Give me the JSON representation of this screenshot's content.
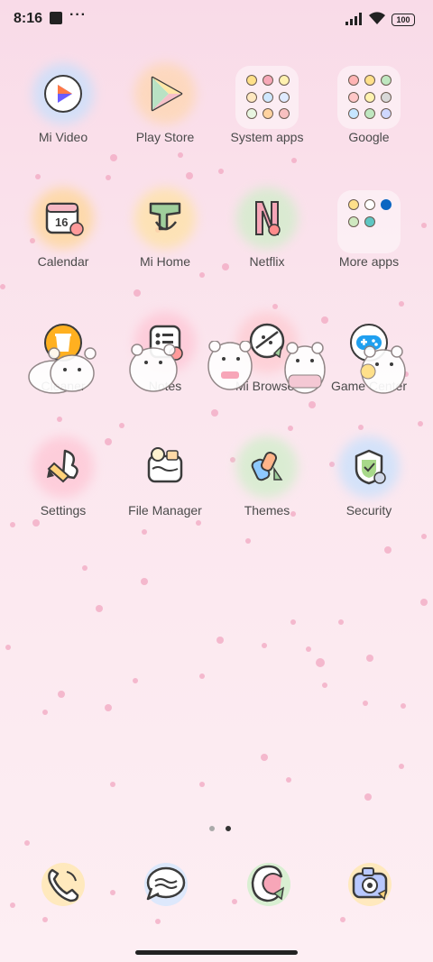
{
  "status_bar": {
    "time": "8:16",
    "more": "···",
    "battery": "100"
  },
  "rows": [
    [
      {
        "label": "Mi Video",
        "icon": "mi-video-icon"
      },
      {
        "label": "Play Store",
        "icon": "play-store-icon"
      },
      {
        "label": "System apps",
        "icon": "folder-icon"
      },
      {
        "label": "Google",
        "icon": "folder-icon"
      }
    ],
    [
      {
        "label": "Calendar",
        "icon": "calendar-icon",
        "badge": "16"
      },
      {
        "label": "Mi Home",
        "icon": "mi-home-icon"
      },
      {
        "label": "Netflix",
        "icon": "netflix-icon"
      },
      {
        "label": "More apps",
        "icon": "folder-icon"
      }
    ],
    [
      {
        "label": "Cleaner",
        "icon": "cleaner-icon"
      },
      {
        "label": "Notes",
        "icon": "notes-icon"
      },
      {
        "label": "Mi Browser",
        "icon": "browser-icon"
      },
      {
        "label": "Game Center",
        "icon": "game-center-icon"
      }
    ],
    [
      {
        "label": "Settings",
        "icon": "settings-icon"
      },
      {
        "label": "File Manager",
        "icon": "file-manager-icon"
      },
      {
        "label": "Themes",
        "icon": "themes-icon"
      },
      {
        "label": "Security",
        "icon": "security-icon"
      }
    ]
  ],
  "dock": [
    "phone-icon",
    "messages-icon",
    "contacts-icon",
    "camera-icon"
  ],
  "pager": {
    "pages": 2,
    "current": 2
  }
}
